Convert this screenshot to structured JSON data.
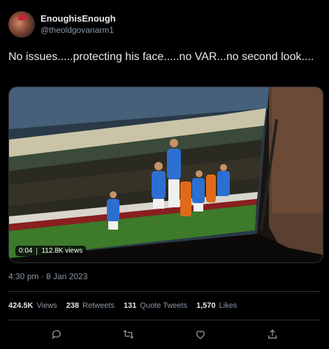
{
  "author": {
    "display_name": "EnoughisEnough",
    "handle": "@theoldgovanarm1"
  },
  "tweet": {
    "text": "No issues.....protecting his face.....no VAR...no second look...."
  },
  "media": {
    "duration": "0:04",
    "views": "112.8K views"
  },
  "timestamp": "4:30 pm · 8 Jan 2023",
  "stats": {
    "views_count": "424.5K",
    "views_label": "Views",
    "retweets_count": "238",
    "retweets_label": "Retweets",
    "quotes_count": "131",
    "quotes_label": "Quote Tweets",
    "likes_count": "1,570",
    "likes_label": "Likes"
  },
  "actions": [
    "reply-icon",
    "retweet-icon",
    "like-icon",
    "share-icon"
  ],
  "colors": {
    "background": "#000000",
    "text": "#e7e9ea",
    "secondary": "#8b98a5",
    "divider": "#2f3336"
  }
}
